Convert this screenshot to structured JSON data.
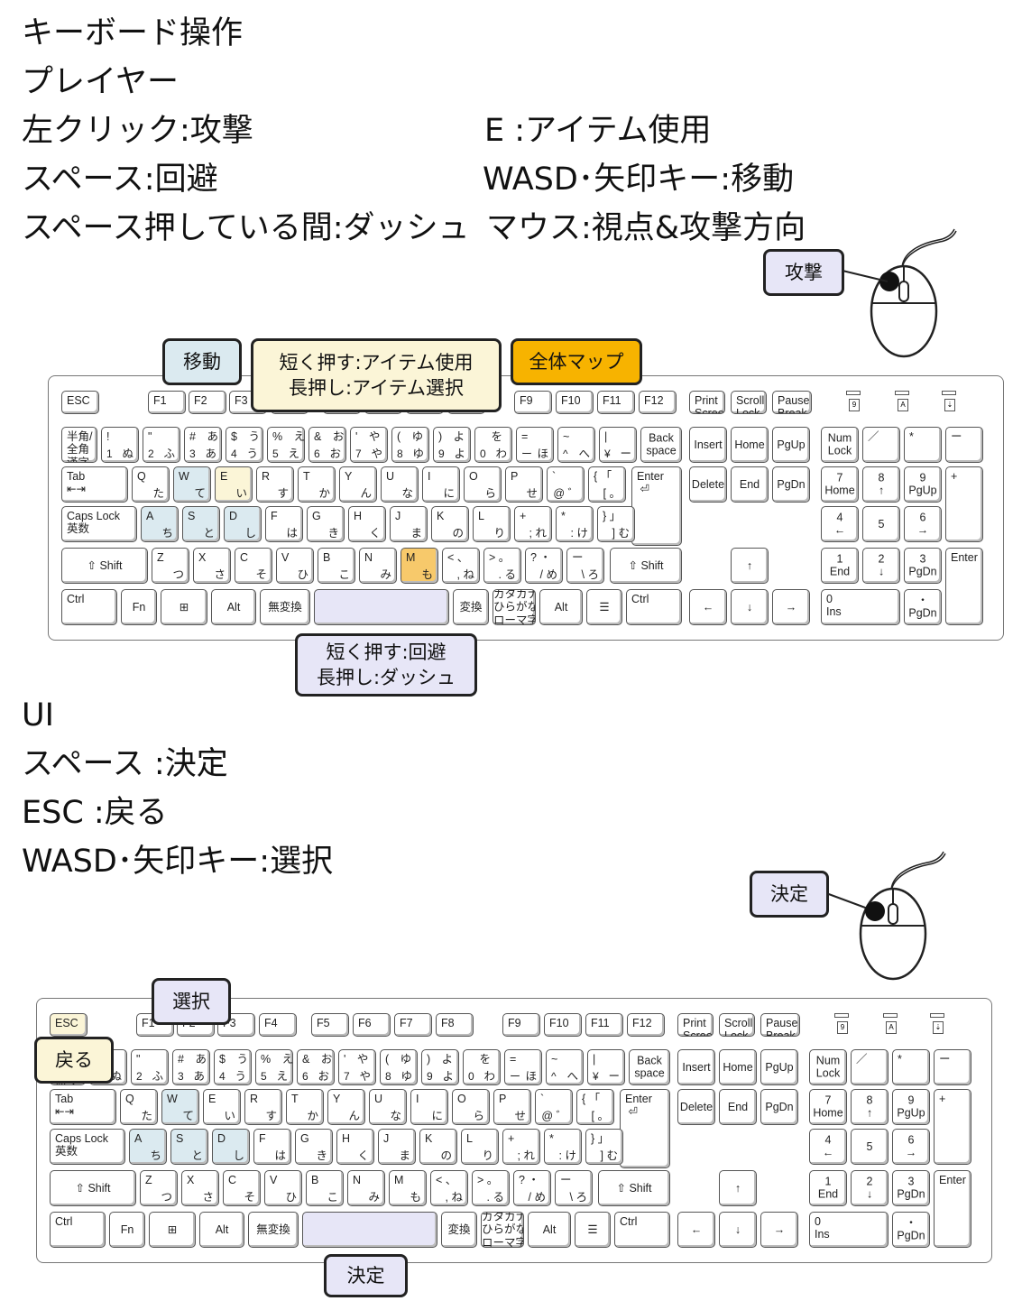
{
  "section1": {
    "heading": "キーボード操作",
    "subheading": "プレイヤー",
    "left_lines": [
      "左クリック:攻撃",
      "スペース:回避",
      "スペース押している間:ダッシュ"
    ],
    "right_lines": [
      "E :アイテム使用",
      "WASD･矢印キー:移動",
      "マウス:視点&攻撃方向"
    ],
    "callouts": {
      "attack": "攻撃",
      "move": "移動",
      "item": [
        "短く押す:アイテム使用",
        "長押し:アイテム選択"
      ],
      "map": "全体マップ",
      "space": [
        "短く押す:回避",
        "長押し:ダッシュ"
      ]
    }
  },
  "section2": {
    "heading": "UI",
    "lines": [
      "スペース :決定",
      "ESC :戻る",
      "WASD･矢印キー:選択"
    ],
    "callouts": {
      "decide_mouse": "決定",
      "select": "選択",
      "back": "戻る",
      "decide_space": "決定"
    }
  },
  "keys": {
    "esc": "ESC",
    "f1": "F1",
    "f2": "F2",
    "f3": "F3",
    "f4": "F4",
    "f5": "F5",
    "f6": "F6",
    "f7": "F7",
    "f8": "F8",
    "f9": "F9",
    "f10": "F10",
    "f11": "F11",
    "f12": "F12",
    "prtsc": "Print\nScreen",
    "scrlk": "Scroll\nLock",
    "pause": "Pause\nBreak",
    "ind": [
      "9",
      "A",
      "⇣"
    ],
    "zenkaku": "半角/\n全角\n漢字",
    "num_row": [
      {
        "t": "!",
        "b": "1",
        "r": "ぬ"
      },
      {
        "t": "\"",
        "b": "2",
        "r": "ふ"
      },
      {
        "t": "#　あ",
        "b": "3",
        "r": "あ"
      },
      {
        "t": "$　う",
        "b": "4",
        "r": "う"
      },
      {
        "t": "%　え",
        "b": "5",
        "r": "え"
      },
      {
        "t": "&　お",
        "b": "6",
        "r": "お"
      },
      {
        "t": "'　や",
        "b": "7",
        "r": "や"
      },
      {
        "t": "(　ゆ",
        "b": "8",
        "r": "ゆ"
      },
      {
        "t": ")　よ",
        "b": "9",
        "r": "よ"
      },
      {
        "t": "　を",
        "b": "0",
        "r": "わ"
      },
      {
        "t": "=",
        "b": "ー",
        "r": "ほ"
      },
      {
        "t": "~",
        "b": "^",
        "r": "へ"
      },
      {
        "t": "|",
        "b": "¥",
        "r": "ー"
      }
    ],
    "backspace": "Back\nspace",
    "tab": "Tab",
    "enter": "Enter",
    "capslock": "Caps Lock",
    "eisu": "英数",
    "shift": "Shift",
    "q_row": [
      {
        "t": "Q",
        "r": "た"
      },
      {
        "t": "W",
        "r": "て"
      },
      {
        "t": "E",
        "r": "い"
      },
      {
        "t": "R",
        "r": "す"
      },
      {
        "t": "T",
        "r": "か"
      },
      {
        "t": "Y",
        "r": "ん"
      },
      {
        "t": "U",
        "r": "な"
      },
      {
        "t": "I",
        "r": "に"
      },
      {
        "t": "O",
        "r": "ら"
      },
      {
        "t": "P",
        "r": "せ"
      },
      {
        "t": "`",
        "r": "@ ゛"
      },
      {
        "t": "{ 「",
        "r": "[ 。"
      }
    ],
    "a_row": [
      {
        "t": "A",
        "r": "ち"
      },
      {
        "t": "S",
        "r": "と"
      },
      {
        "t": "D",
        "r": "し"
      },
      {
        "t": "F",
        "r": "は"
      },
      {
        "t": "G",
        "r": "き"
      },
      {
        "t": "H",
        "r": "く"
      },
      {
        "t": "J",
        "r": "ま"
      },
      {
        "t": "K",
        "r": "の"
      },
      {
        "t": "L",
        "r": "り"
      },
      {
        "t": "+",
        "r": "; れ"
      },
      {
        "t": "*",
        "r": ": け"
      },
      {
        "t": "} 」",
        "r": "] む"
      }
    ],
    "z_row": [
      {
        "t": "Z",
        "r": "つ"
      },
      {
        "t": "X",
        "r": "さ"
      },
      {
        "t": "C",
        "r": "そ"
      },
      {
        "t": "V",
        "r": "ひ"
      },
      {
        "t": "B",
        "r": "こ"
      },
      {
        "t": "N",
        "r": "み"
      },
      {
        "t": "M",
        "r": "も"
      },
      {
        "t": "< 、",
        "r": ", ね"
      },
      {
        "t": "> 。",
        "r": ". る"
      },
      {
        "t": "? ・",
        "r": "/ め"
      },
      {
        "t": "ー",
        "r": "\\ ろ"
      }
    ],
    "ctrl": "Ctrl",
    "fn": "Fn",
    "alt": "Alt",
    "muhenkan": "無変換",
    "henkan": "変換",
    "kana": "カタカナ\nひらがな\nローマ字",
    "insert": "Insert",
    "home": "Home",
    "pgup": "PgUp",
    "delete": "Delete",
    "end": "End",
    "pgdn": "PgDn",
    "up": "↑",
    "down": "↓",
    "left": "←",
    "right": "→",
    "numlock": "Num\nLock",
    "slash": "／",
    "star": "*",
    "minus": "ー",
    "plus": "+",
    "np_enter": "Enter",
    "n7": "7\nHome",
    "n8": "8\n↑",
    "n9": "9\nPgUp",
    "n4": "4\n←",
    "n5": "5",
    "n6": "6\n→",
    "n1": "1\nEnd",
    "n2": "2\n↓",
    "n3": "3\nPgDn",
    "n0": "0\nIns",
    "ndot": "・\nPgDn"
  },
  "colors": {
    "blue": "#dbeaf0",
    "cream": "#fbf5d7",
    "orange": "#f7c96b",
    "lavender": "#e7e6f7",
    "callout_orange": "#f7b300"
  }
}
